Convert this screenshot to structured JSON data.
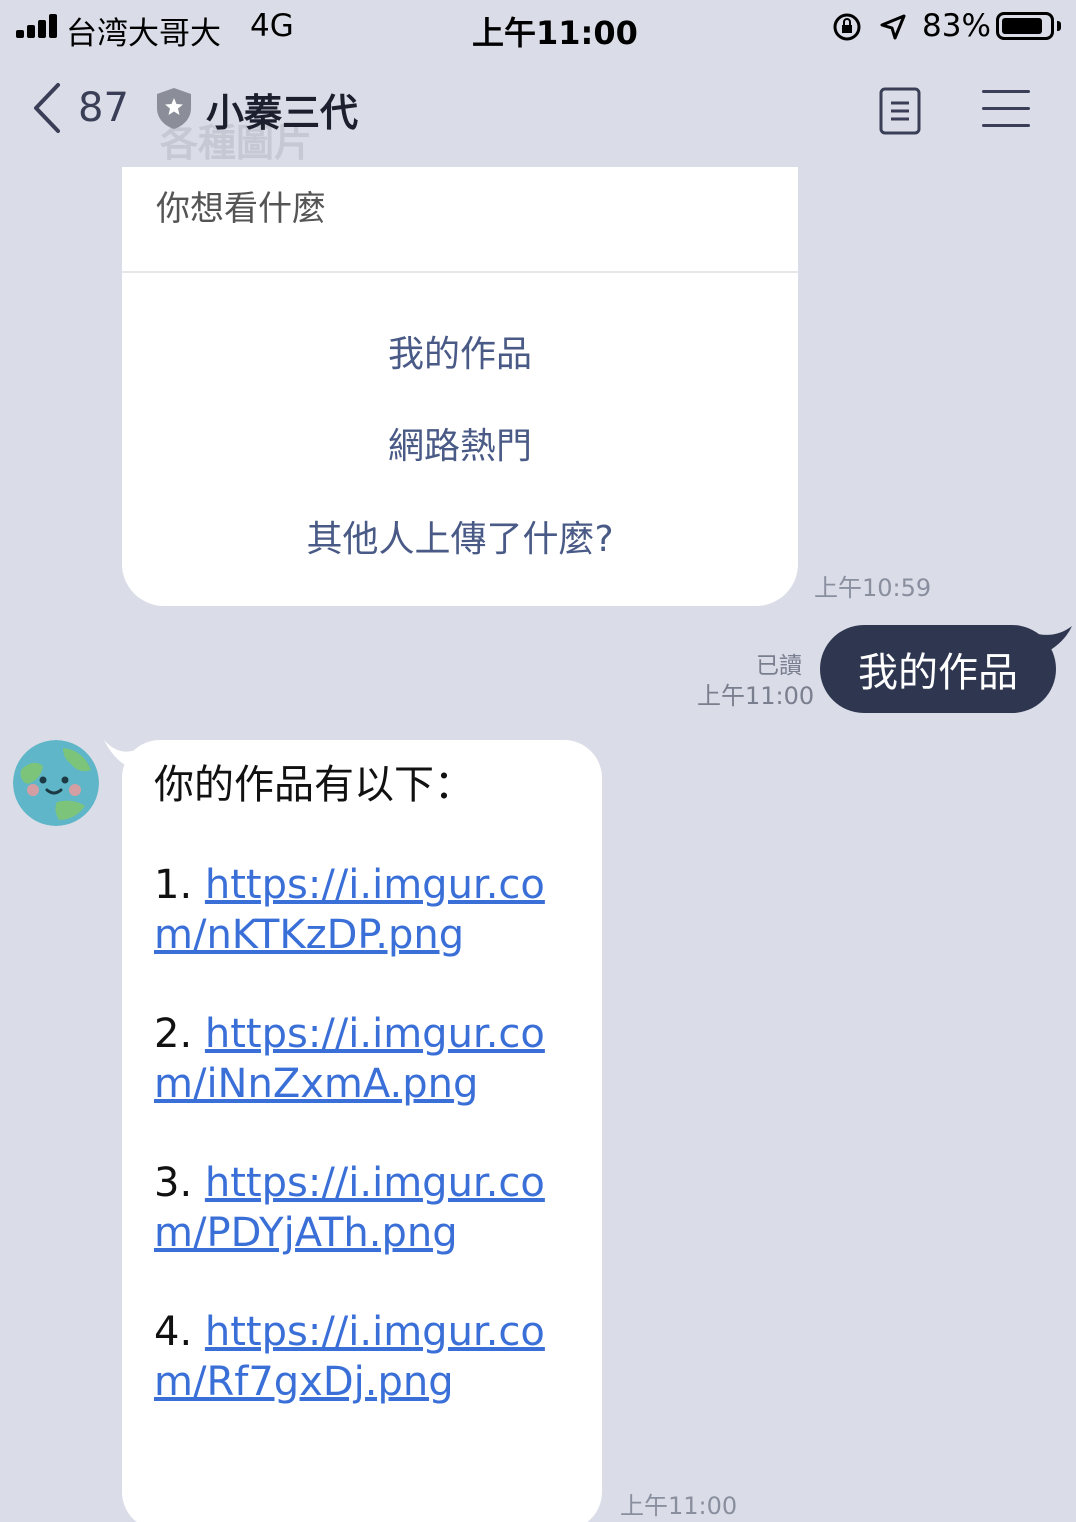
{
  "status_bar": {
    "carrier": "台湾大哥大",
    "network": "4G",
    "time": "上午11:00",
    "battery": "83%",
    "battery_level": 0.83
  },
  "header": {
    "unread_count": "87",
    "title": "小蓁三代",
    "ghost_text": "各種圖片",
    "icons": [
      "back-chevron-icon",
      "shield-icon",
      "notes-icon",
      "menu-icon"
    ]
  },
  "quick_reply": {
    "prompt": "你想看什麼",
    "options": [
      "我的作品",
      "網路熱門",
      "其他人上傳了什麼?"
    ],
    "timestamp": "上午10:59"
  },
  "outgoing": {
    "read_label": "已讀",
    "timestamp": "上午11:00",
    "text": "我的作品",
    "bubble_color": "#2e3650"
  },
  "incoming": {
    "heading": "你的作品有以下：",
    "links": [
      {
        "num": "1.",
        "url": "https://i.imgur.com/nKTKzDP.png"
      },
      {
        "num": "2.",
        "url": "https://i.imgur.com/iNnZxmA.png"
      },
      {
        "num": "3.",
        "url": "https://i.imgur.com/PDYjATh.png"
      },
      {
        "num": "4.",
        "url": "https://i.imgur.com/Rf7gxDj.png"
      }
    ],
    "timestamp": "上午11:00",
    "link_color": "#3a6fd8"
  },
  "colors": {
    "background": "#dadde7",
    "accent": "#4a5a86"
  }
}
